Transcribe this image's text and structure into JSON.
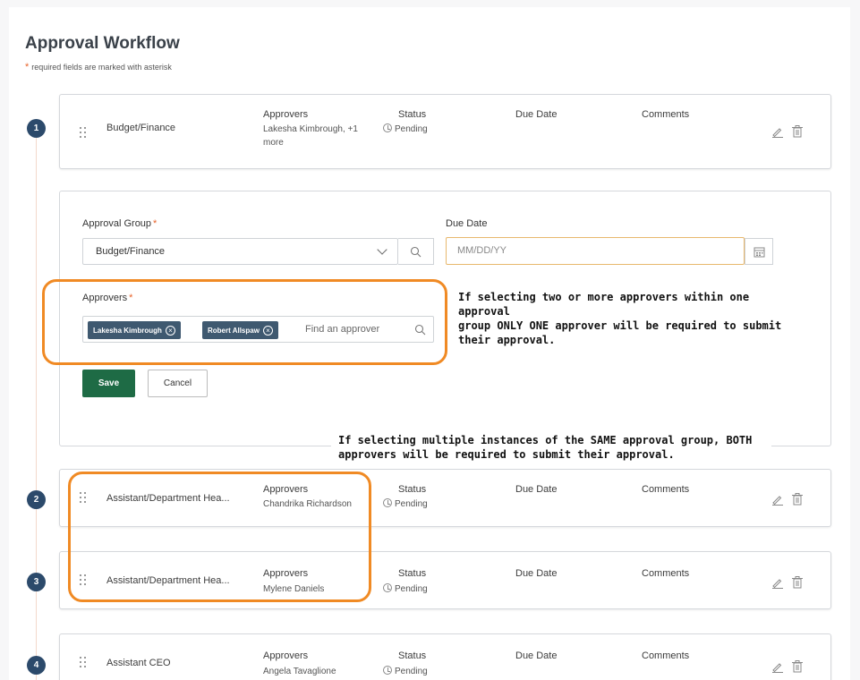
{
  "page": {
    "title": "Approval Workflow",
    "required_note": "required fields are marked with asterisk",
    "required_star": "*"
  },
  "columns": {
    "approvers": "Approvers",
    "status": "Status",
    "due_date": "Due Date",
    "comments": "Comments"
  },
  "steps": [
    {
      "number": "1",
      "group": "Budget/Finance",
      "approvers_line1": "Lakesha Kimbrough, +1",
      "approvers_line2": "more",
      "status": "Pending"
    },
    {
      "number": "2",
      "group": "Assistant/Department Hea...",
      "approvers_line1": "Chandrika Richardson",
      "status": "Pending"
    },
    {
      "number": "3",
      "group": "Assistant/Department Hea...",
      "approvers_line1": "Mylene Daniels",
      "status": "Pending"
    },
    {
      "number": "4",
      "group": "Assistant CEO",
      "approvers_line1": "Angela Tavaglione",
      "status": "Pending"
    }
  ],
  "form": {
    "group_label": "Approval Group",
    "group_value": "Budget/Finance",
    "due_label": "Due Date",
    "due_placeholder": "MM/DD/YY",
    "approvers_label": "Approvers",
    "chips": [
      "Lakesha Kimbrough",
      "Robert Allspaw"
    ],
    "find_placeholder": "Find an approver",
    "save_label": "Save",
    "cancel_label": "Cancel",
    "asterisk": "*"
  },
  "annotations": {
    "note1_line1": "If selecting two or more approvers within one approval",
    "note1_line2": "group ONLY ONE approver will be required to submit",
    "note1_line3": "their approval.",
    "note2_line1": "If selecting multiple instances of the SAME approval group, BOTH",
    "note2_line2": "approvers will be required to submit their approval."
  },
  "colors": {
    "accent_orange": "#f08a24",
    "save_green": "#1e6b45",
    "step_navy": "#2c4a6b",
    "chip_slate": "#3f5970"
  }
}
